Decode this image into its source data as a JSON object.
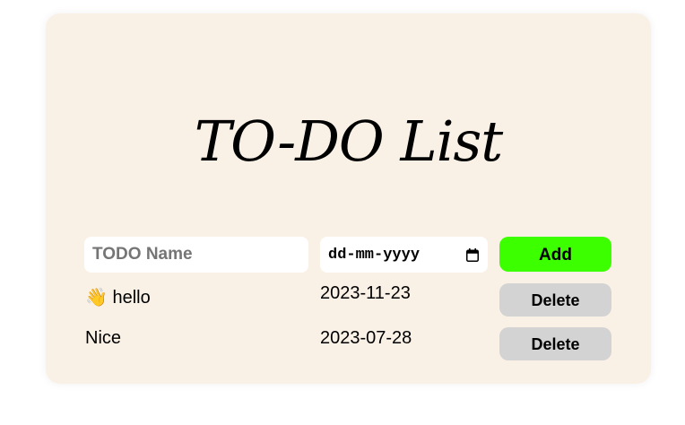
{
  "page": {
    "title": "TO-DO List"
  },
  "form": {
    "name_placeholder": "TODO Name",
    "date_placeholder": "dd-mm-yyyy",
    "add_label": "Add"
  },
  "todos": [
    {
      "name": "👋 hello",
      "date": "2023-11-23",
      "delete_label": "Delete"
    },
    {
      "name": "Nice",
      "date": "2023-07-28",
      "delete_label": "Delete"
    }
  ],
  "colors": {
    "card_background": "#faf1e6",
    "add_button": "#3cff00",
    "delete_button": "#d3d3d3"
  },
  "icons": {
    "date_picker": "calendar-icon"
  }
}
